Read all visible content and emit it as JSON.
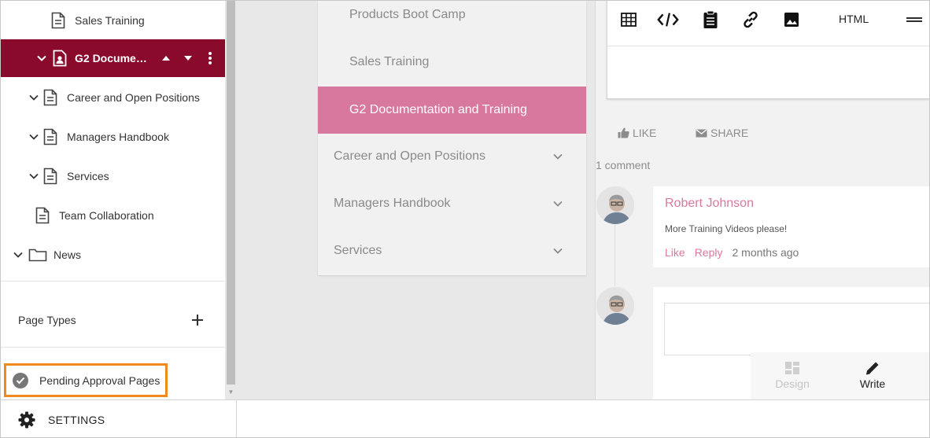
{
  "sidebar": {
    "tree": [
      {
        "label": "Sales Training",
        "expandable": false
      },
      {
        "label": "G2 Document...",
        "expandable": true,
        "active": true
      },
      {
        "label": "Career and Open Positions",
        "expandable": true
      },
      {
        "label": "Managers Handbook",
        "expandable": true
      },
      {
        "label": "Services",
        "expandable": true
      },
      {
        "label": "Team Collaboration",
        "expandable": false
      },
      {
        "label": "News",
        "expandable": true,
        "type": "folder"
      }
    ],
    "page_types_label": "Page Types",
    "pending_label": "Pending Approval Pages",
    "settings_label": "SETTINGS"
  },
  "nav": {
    "items": [
      {
        "label": "Products Boot Camp",
        "level": "sub"
      },
      {
        "label": "Sales Training",
        "level": "sub"
      },
      {
        "label": "G2 Documentation and Training",
        "level": "sub",
        "active": true
      },
      {
        "label": "Career and Open Positions",
        "level": "top"
      },
      {
        "label": "Managers Handbook",
        "level": "top"
      },
      {
        "label": "Services",
        "level": "top"
      }
    ]
  },
  "editor": {
    "toolbar": {
      "table_icon": "table-icon",
      "code_icon": "code-icon",
      "clipboard_icon": "clipboard-icon",
      "link_icon": "link-icon",
      "image_icon": "image-icon",
      "html_label": "HTML",
      "menu_icon": "menu-icon"
    }
  },
  "social": {
    "like_label": "LIKE",
    "share_label": "SHARE",
    "comment_count": "1 comment"
  },
  "comment": {
    "author": "Robert Johnson",
    "text": "More Training Videos please!",
    "like": "Like",
    "reply": "Reply",
    "time": "2 months ago"
  },
  "mode": {
    "design_label": "Design",
    "write_label": "Write"
  },
  "colors": {
    "active_tree": "#8a0a2c",
    "accent_pink": "#d9789f",
    "highlight_box": "#f0891e"
  }
}
